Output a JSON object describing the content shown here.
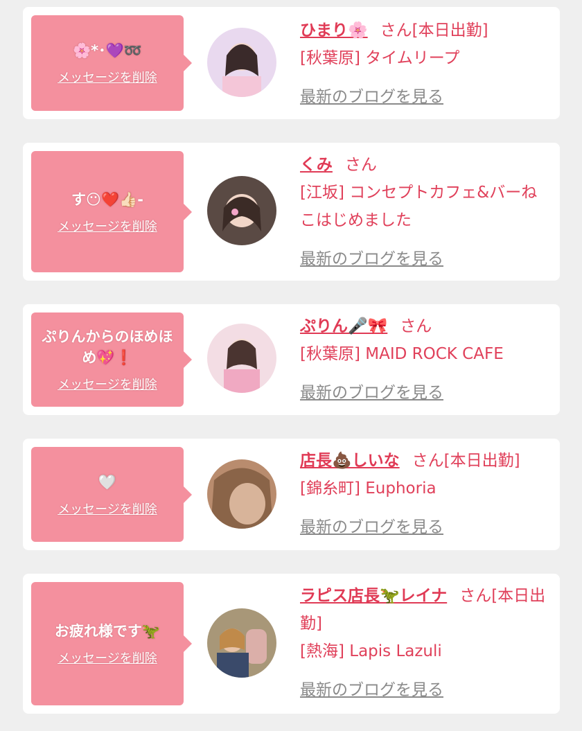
{
  "cards": [
    {
      "message": "🌸*･💜➿",
      "delete_label": "メッセージを削除",
      "name": "ひまり🌸",
      "suffix": "さん[本日出勤]",
      "shop": "[秋葉原] タイムリープ",
      "blog_label": "最新のブログを見る"
    },
    {
      "message": "す😶❤️👍🏻-",
      "delete_label": "メッセージを削除",
      "name": "くみ",
      "suffix": "さん",
      "shop": "[江坂] コンセプトカフェ&バーねこはじめました",
      "blog_label": "最新のブログを見る"
    },
    {
      "message": "ぷりんからのほめほめ💖❗️",
      "delete_label": "メッセージを削除",
      "name": "ぷりん🎤🎀",
      "suffix": "さん",
      "shop": "[秋葉原] MAID ROCK CAFE",
      "blog_label": "最新のブログを見る"
    },
    {
      "message": "🤍",
      "delete_label": "メッセージを削除",
      "name": "店長💩しいな",
      "suffix": "さん[本日出勤]",
      "shop": "[錦糸町] Euphoria",
      "blog_label": "最新のブログを見る"
    },
    {
      "message": "お疲れ様です🦖",
      "delete_label": "メッセージを削除",
      "name": "ラピス店長🦖レイナ",
      "suffix": "さん[本日出勤]",
      "shop": "[熱海] Lapis Lazuli",
      "blog_label": "最新のブログを見る"
    }
  ],
  "colors": {
    "bubble": "#f4909e",
    "accent": "#e03a55",
    "link_gray": "#8a8a8a",
    "background": "#efefef"
  }
}
